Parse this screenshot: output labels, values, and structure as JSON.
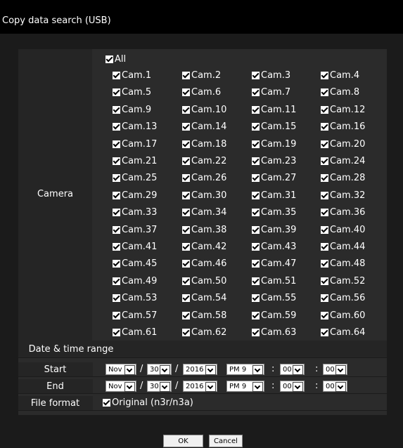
{
  "window": {
    "title": "Copy data search (USB)"
  },
  "camera": {
    "label": "Camera",
    "all_label": "All",
    "cams": [
      "Cam.1",
      "Cam.2",
      "Cam.3",
      "Cam.4",
      "Cam.5",
      "Cam.6",
      "Cam.7",
      "Cam.8",
      "Cam.9",
      "Cam.10",
      "Cam.11",
      "Cam.12",
      "Cam.13",
      "Cam.14",
      "Cam.15",
      "Cam.16",
      "Cam.17",
      "Cam.18",
      "Cam.19",
      "Cam.20",
      "Cam.21",
      "Cam.22",
      "Cam.23",
      "Cam.24",
      "Cam.25",
      "Cam.26",
      "Cam.27",
      "Cam.28",
      "Cam.29",
      "Cam.30",
      "Cam.31",
      "Cam.32",
      "Cam.33",
      "Cam.34",
      "Cam.35",
      "Cam.36",
      "Cam.37",
      "Cam.38",
      "Cam.39",
      "Cam.40",
      "Cam.41",
      "Cam.42",
      "Cam.43",
      "Cam.44",
      "Cam.45",
      "Cam.46",
      "Cam.47",
      "Cam.48",
      "Cam.49",
      "Cam.50",
      "Cam.51",
      "Cam.52",
      "Cam.53",
      "Cam.54",
      "Cam.55",
      "Cam.56",
      "Cam.57",
      "Cam.58",
      "Cam.59",
      "Cam.60",
      "Cam.61",
      "Cam.62",
      "Cam.63",
      "Cam.64"
    ]
  },
  "date_range": {
    "heading": "Date & time range",
    "start": {
      "label": "Start",
      "month": "Nov",
      "day": "30",
      "year": "2016",
      "hour": "PM 9",
      "minute": "00",
      "second": "00"
    },
    "end": {
      "label": "End",
      "month": "Nov",
      "day": "30",
      "year": "2016",
      "hour": "PM 9",
      "minute": "00",
      "second": "00"
    },
    "date_sep": "/",
    "time_sep": ":"
  },
  "file_format": {
    "label": "File format",
    "option": "Original (n3r/n3a)"
  },
  "buttons": {
    "ok": "OK",
    "cancel": "Cancel"
  }
}
